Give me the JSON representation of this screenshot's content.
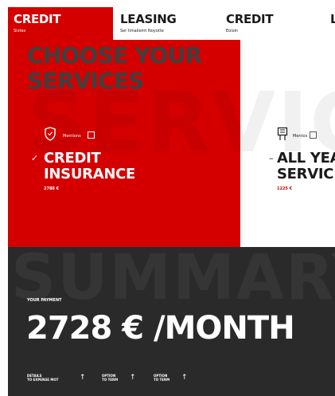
{
  "tabs": [
    {
      "title": "CREDIT",
      "subtitle": "Sixtes"
    },
    {
      "title": "LEASING",
      "subtitle": "Ser Iimaliemt Noyotte"
    },
    {
      "title": "CREDIT",
      "subtitle": "Eoioin"
    },
    {
      "title": "L",
      "subtitle": ""
    }
  ],
  "services": {
    "heading_line1": "CHOOSE YOUR",
    "heading_line2": "SERVICES",
    "watermark": "SERVICE",
    "cards": [
      {
        "tag": "Mentions",
        "name_line1": "CREDIT",
        "name_line2": "INSURANCE",
        "price": "2788 €",
        "icon": "shield-icon",
        "mark": "✓"
      },
      {
        "tag": "Mentos",
        "name_line1": "ALL YEA",
        "name_line2": "SERVIC",
        "price": "1225 €",
        "icon": "building-icon",
        "mark": "–"
      }
    ]
  },
  "summary": {
    "watermark": "SUMMARY",
    "payment_label": "YOUR PAYMENT",
    "payment_amount": "2728 € /MONTH",
    "options": [
      {
        "line1": "DETAILS",
        "line2": "TO EXPENSE MOT"
      },
      {
        "line1": "OPTION",
        "line2": "TO TERM"
      },
      {
        "line1": "OPTION",
        "line2": "TO TERM"
      }
    ]
  },
  "colors": {
    "brand_red": "#d40000",
    "summary_background": "#2a2a2a",
    "heading_text": "#3f3f3f"
  }
}
